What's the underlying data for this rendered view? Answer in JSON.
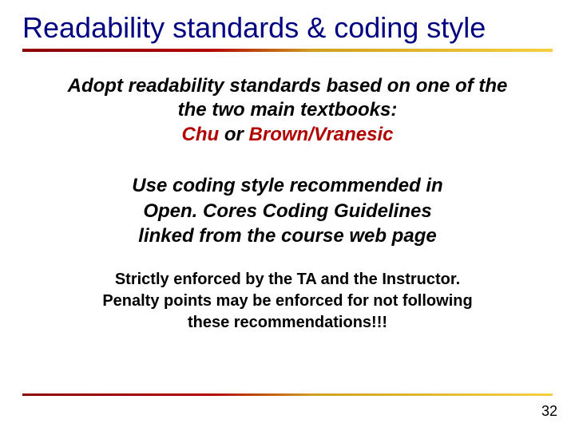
{
  "title": "Readability standards & coding style",
  "section1": {
    "line1": "Adopt readability standards based on one of the",
    "line2": "the two main textbooks:",
    "option1": "Chu",
    "or": " or ",
    "option2": "Brown/Vranesic"
  },
  "section2": {
    "line1": "Use coding style recommended in",
    "line2": "Open. Cores Coding Guidelines",
    "line3": "linked from the course web page"
  },
  "section3": {
    "line1": "Strictly enforced by the TA and the Instructor.",
    "line2": "Penalty points may be enforced for not following",
    "line3": "these recommendations!!!"
  },
  "page_number": "32"
}
